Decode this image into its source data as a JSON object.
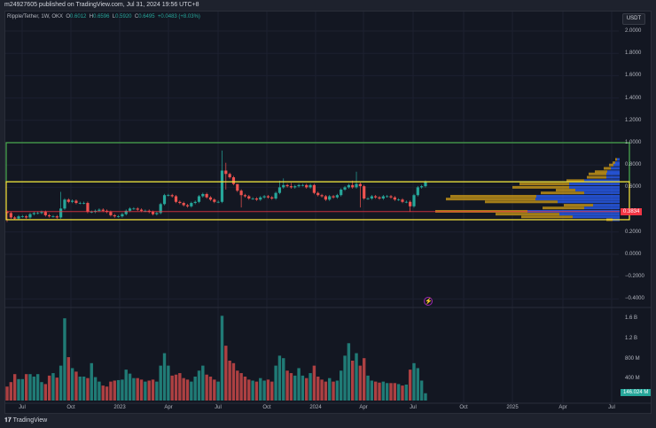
{
  "header": {
    "published": "m24927605 published on TradingView.com, Jul 31, 2024 19:56 UTC+8"
  },
  "legend": {
    "symbol": "Ripple/Tether, 1W, OKX",
    "o_label": "O",
    "o": "0.6012",
    "h_label": "H",
    "h": "0.6596",
    "l_label": "L",
    "l": "0.5920",
    "c_label": "C",
    "c": "0.6495",
    "change": "+0.0483 (+8.03%)"
  },
  "currency": "USDT",
  "price_ticks": [
    2.0,
    1.8,
    1.6,
    1.4,
    1.2,
    1.0,
    0.8,
    0.6,
    0.2,
    0.0,
    -0.2,
    -0.4
  ],
  "price_tick_labels": [
    "2.0000",
    "1.8000",
    "1.6000",
    "1.4000",
    "1.2000",
    "1.0000",
    "0.8000",
    "0.6000",
    "0.2000",
    "0.0000",
    "−0.2000",
    "−0.4000"
  ],
  "volume_ticks": [
    "1.6 B",
    "1.2 B",
    "800 M",
    "400 M"
  ],
  "time_labels": [
    "Jul",
    "Oct",
    "2023",
    "Apr",
    "Jul",
    "Oct",
    "2024",
    "Apr",
    "Jul",
    "Oct",
    "2025",
    "Apr",
    "Jul"
  ],
  "tags": {
    "red_line": "0.3834",
    "volume": "146.024 M"
  },
  "colors": {
    "up": "#26a69a",
    "down": "#ef5350",
    "green_box": "#4caf50",
    "yellow_box": "#ffeb3b",
    "red_line": "#f23645",
    "vp_up": "#2962ff",
    "vp_down": "#d4a017"
  },
  "zones": {
    "green_box": [
      0.65,
      1.0
    ],
    "yellow_box": [
      0.31,
      0.65
    ],
    "red_line": 0.3834
  },
  "chart_data": {
    "type": "candlestick",
    "interval": "1W",
    "first_open": 0.38,
    "closes": [
      0.37,
      0.33,
      0.32,
      0.34,
      0.34,
      0.33,
      0.36,
      0.37,
      0.37,
      0.38,
      0.35,
      0.34,
      0.34,
      0.33,
      0.41,
      0.49,
      0.47,
      0.48,
      0.46,
      0.46,
      0.46,
      0.38,
      0.38,
      0.39,
      0.4,
      0.39,
      0.38,
      0.35,
      0.34,
      0.34,
      0.36,
      0.39,
      0.41,
      0.41,
      0.4,
      0.39,
      0.39,
      0.38,
      0.36,
      0.37,
      0.45,
      0.53,
      0.53,
      0.52,
      0.47,
      0.46,
      0.44,
      0.43,
      0.46,
      0.47,
      0.52,
      0.54,
      0.51,
      0.49,
      0.47,
      0.47,
      0.75,
      0.72,
      0.69,
      0.63,
      0.57,
      0.53,
      0.52,
      0.5,
      0.5,
      0.49,
      0.51,
      0.52,
      0.51,
      0.5,
      0.55,
      0.6,
      0.62,
      0.61,
      0.6,
      0.61,
      0.62,
      0.62,
      0.6,
      0.62,
      0.55,
      0.53,
      0.52,
      0.49,
      0.52,
      0.51,
      0.53,
      0.58,
      0.6,
      0.62,
      0.6,
      0.63,
      0.61,
      0.5,
      0.5,
      0.52,
      0.51,
      0.5,
      0.52,
      0.52,
      0.51,
      0.49,
      0.49,
      0.47,
      0.47,
      0.43,
      0.53,
      0.6,
      0.61,
      0.6495
    ],
    "high_overrides": {
      "14": 0.56,
      "56": 0.93,
      "57": 0.82,
      "60": 0.6,
      "71": 0.66,
      "72": 0.68,
      "74": 0.64,
      "90": 0.66,
      "91": 0.74
    },
    "low_overrides": {
      "0": 0.29,
      "57": 0.58,
      "61": 0.42,
      "92": 0.42,
      "105": 0.38
    },
    "volumes_m": [
      280,
      370,
      530,
      430,
      430,
      530,
      530,
      480,
      530,
      370,
      330,
      500,
      550,
      460,
      700,
      1650,
      870,
      650,
      580,
      480,
      480,
      450,
      750,
      470,
      380,
      300,
      280,
      380,
      400,
      410,
      420,
      620,
      540,
      450,
      450,
      420,
      380,
      400,
      420,
      380,
      700,
      950,
      700,
      500,
      520,
      550,
      450,
      420,
      380,
      480,
      600,
      700,
      520,
      480,
      420,
      380,
      1700,
      1100,
      800,
      750,
      600,
      550,
      480,
      420,
      400,
      380,
      450,
      400,
      420,
      380,
      700,
      900,
      850,
      600,
      550,
      500,
      650,
      500,
      450,
      550,
      700,
      480,
      420,
      380,
      450,
      380,
      400,
      600,
      900,
      1150,
      800,
      950,
      700,
      850,
      500,
      400,
      380,
      360,
      380,
      350,
      350,
      350,
      330,
      300,
      320,
      620,
      750,
      650,
      400,
      146
    ],
    "volume_profile": [
      {
        "price": 0.85,
        "up": 3,
        "down": 2
      },
      {
        "price": 0.82,
        "up": 5,
        "down": 3
      },
      {
        "price": 0.8,
        "up": 7,
        "down": 5
      },
      {
        "price": 0.77,
        "up": 10,
        "down": 8
      },
      {
        "price": 0.74,
        "up": 14,
        "down": 14
      },
      {
        "price": 0.72,
        "up": 15,
        "down": 20
      },
      {
        "price": 0.69,
        "up": 15,
        "down": 22
      },
      {
        "price": 0.66,
        "up": 40,
        "down": 20
      },
      {
        "price": 0.63,
        "up": 57,
        "down": 56
      },
      {
        "price": 0.6,
        "up": 57,
        "down": 64
      },
      {
        "price": 0.575,
        "up": 50,
        "down": 22
      },
      {
        "price": 0.55,
        "up": 40,
        "down": 49
      },
      {
        "price": 0.52,
        "up": 94,
        "down": 97
      },
      {
        "price": 0.495,
        "up": 95,
        "down": 101
      },
      {
        "price": 0.47,
        "up": 70,
        "down": 82
      },
      {
        "price": 0.44,
        "up": 30,
        "down": 33
      },
      {
        "price": 0.415,
        "up": 40,
        "down": 47
      },
      {
        "price": 0.385,
        "up": 104,
        "down": 104
      },
      {
        "price": 0.36,
        "up": 68,
        "down": 72
      },
      {
        "price": 0.335,
        "up": 53,
        "down": 58
      },
      {
        "price": 0.31,
        "up": 8,
        "down": 7
      }
    ]
  },
  "logo": "TradingView"
}
